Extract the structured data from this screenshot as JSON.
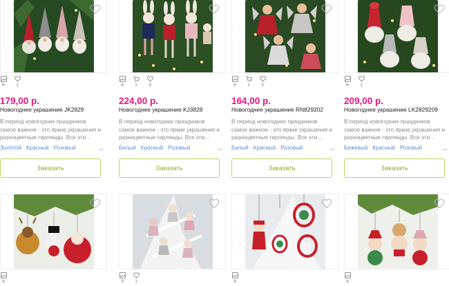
{
  "products": [
    {
      "price": "179,00 р.",
      "title": "Новогоднее украшение JK2829",
      "desc": "В период новогодних праздников самое важное - это яркие украшения и разноцветные гирлянды. Все эти...",
      "colors": [
        "Золотой",
        "Красный",
        "Розовый"
      ],
      "more": "...",
      "stats": [
        {
          "icon": "image-icon",
          "value": "6"
        },
        {
          "icon": "heart-icon",
          "value": "1"
        }
      ],
      "button": "Заказать"
    },
    {
      "price": "224,00 р.",
      "title": "Новогоднее украшение KJ3828",
      "desc": "В период новогодних праздников самое важное - это яркие украшения и разноцветные гирлянды. Все эти...",
      "colors": [
        "Белый",
        "Красный",
        "Розовый"
      ],
      "more": "...",
      "stats": [
        {
          "icon": "image-icon",
          "value": "8"
        },
        {
          "icon": "cart-icon",
          "value": "1"
        },
        {
          "icon": "heart-icon",
          "value": "3"
        }
      ],
      "button": "Заказать"
    },
    {
      "price": "164,00 р.",
      "title": "Новогоднее украшение RN829202",
      "desc": "В период новогодних праздников самое важное - это яркие украшения и разноцветные гирлянды. Все эти...",
      "colors": [
        "Белый",
        "Красный",
        "Розовый"
      ],
      "more": "...",
      "stats": [
        {
          "icon": "image-icon",
          "value": "6"
        },
        {
          "icon": "cart-icon",
          "value": "1"
        },
        {
          "icon": "heart-icon",
          "value": "3"
        }
      ],
      "button": "Заказать"
    },
    {
      "price": "209,00 р.",
      "title": "Новогоднее украшение LK2829209",
      "desc": "В период новогодних праздников самое важное - это яркие украшения и разноцветные гирлянды. Все эти...",
      "colors": [
        "Бежевый",
        "Красный",
        "Розовый"
      ],
      "more": "...",
      "stats": [
        {
          "icon": "image-icon",
          "value": "6"
        },
        {
          "icon": "heart-icon",
          "value": "1"
        }
      ],
      "button": "Заказать"
    }
  ],
  "products_row2": [
    {
      "stats": [
        {
          "icon": "image-icon",
          "value": "6"
        }
      ]
    },
    {
      "stats": [
        {
          "icon": "image-icon",
          "value": "9"
        },
        {
          "icon": "heart-icon",
          "value": "1"
        }
      ]
    },
    {
      "stats": [
        {
          "icon": "image-icon",
          "value": "6"
        }
      ]
    },
    {
      "stats": [
        {
          "icon": "image-icon",
          "value": "6"
        }
      ]
    }
  ],
  "colors": {
    "price": "#e5197d",
    "accent": "#8fb21e",
    "link": "#5a8fd0",
    "tree": "#2f5a2a"
  }
}
